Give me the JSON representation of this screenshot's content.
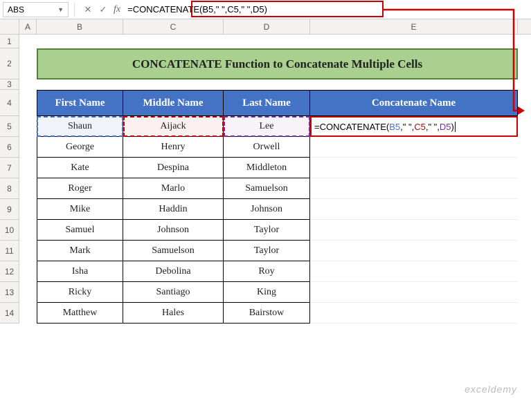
{
  "name_box": "ABS",
  "formula": "=CONCATENATE(B5,\" \",C5,\" \",D5)",
  "columns": [
    "A",
    "B",
    "C",
    "D",
    "E"
  ],
  "rows": [
    "1",
    "2",
    "3",
    "4",
    "5",
    "6",
    "7",
    "8",
    "9",
    "10",
    "11",
    "12",
    "13",
    "14"
  ],
  "title": "CONCATENATE Function to Concatenate Multiple Cells",
  "headers": {
    "b": "First Name",
    "c": "Middle Name",
    "d": "Last Name",
    "e": "Concatenate Name"
  },
  "table": [
    {
      "b": "Shaun",
      "c": "Aijack",
      "d": "Lee"
    },
    {
      "b": "George",
      "c": "Henry",
      "d": "Orwell"
    },
    {
      "b": "Kate",
      "c": "Despina",
      "d": "Middleton"
    },
    {
      "b": "Roger",
      "c": "Marlo",
      "d": "Samuelson"
    },
    {
      "b": "Mike",
      "c": "Haddin",
      "d": "Johnson"
    },
    {
      "b": "Samuel",
      "c": "Johnson",
      "d": "Taylor"
    },
    {
      "b": "Mark",
      "c": "Samuelson",
      "d": "Taylor"
    },
    {
      "b": "Isha",
      "c": "Debolina",
      "d": "Roy"
    },
    {
      "b": "Ricky",
      "c": "Santiago",
      "d": "King"
    },
    {
      "b": "Matthew",
      "c": "Hales",
      "d": "Bairstow"
    }
  ],
  "e5_tokens": {
    "fn": "=CONCATENATE(",
    "b": "B5",
    "sep1": ",\" \",",
    "c": "C5",
    "sep2": ",\" \",",
    "d": "D5",
    "close": ")"
  },
  "watermark": "exceldemy"
}
